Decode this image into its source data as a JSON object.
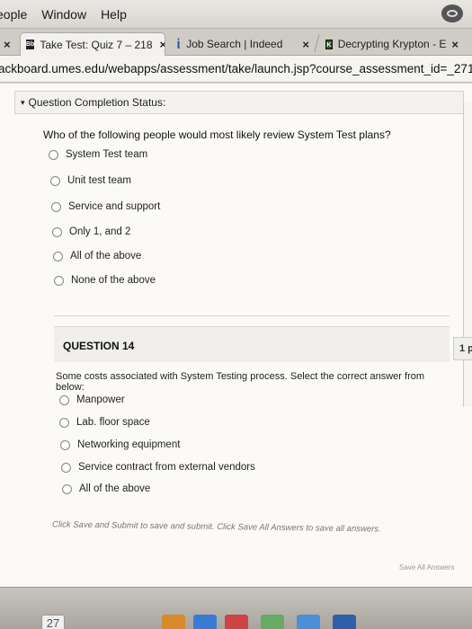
{
  "os_menu": {
    "items": [
      "eople",
      "Window",
      "Help"
    ]
  },
  "tabs": [
    {
      "label": "Take Test: Quiz 7 – 218",
      "close": "×",
      "favicon": "Bb"
    },
    {
      "label": "Job Search | Indeed",
      "close": "×",
      "favicon": "indeed-icon"
    },
    {
      "label": "Decrypting Krypton - E",
      "close": "×",
      "favicon": "krypton-icon"
    }
  ],
  "first_tab_close": "×",
  "address": {
    "url": "ackboard.umes.edu/webapps/assessment/take/launch.jsp?course_assessment_id=_2710_1&c"
  },
  "status": {
    "label": "Question Completion Status:"
  },
  "q13": {
    "text": "Who of the following people would most likely review System Test plans?",
    "options": [
      "System Test team",
      "Unit test team",
      "Service and support",
      "Only 1, and 2",
      "All of the above",
      "None of the above"
    ]
  },
  "q14": {
    "title": "QUESTION 14",
    "points": "1 p",
    "text": "Some costs associated with System Testing process. Select the correct answer from below:",
    "options": [
      "Manpower",
      "Lab. floor space",
      "Networking equipment",
      "Service contract from external vendors",
      "All of the above"
    ]
  },
  "footer": {
    "note": "Click Save and Submit to save and submit. Click Save All Answers to save all answers.",
    "save_all": "Save All Answers"
  },
  "dock": {
    "calendar_day": "27"
  }
}
